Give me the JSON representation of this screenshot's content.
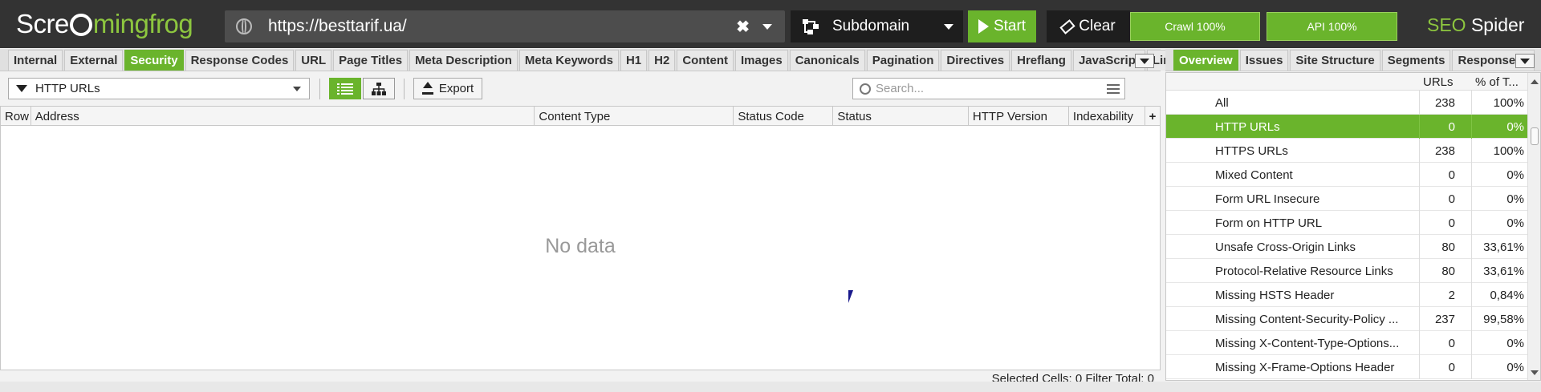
{
  "app": {
    "logo_left": "Scre",
    "logo_right": "mingfrog",
    "product_seo": "SEO",
    "product_spider": " Spider"
  },
  "topbar": {
    "url": "https://besttarif.ua/",
    "mode": "Subdomain",
    "start_label": "Start",
    "clear_label": "Clear",
    "crawl_progress": "Crawl 100%",
    "api_progress": "API 100%"
  },
  "colors": {
    "accent": "#6ab42c",
    "topbar": "#333333"
  },
  "left_tabs": [
    {
      "label": "Internal",
      "active": false
    },
    {
      "label": "External",
      "active": false
    },
    {
      "label": "Security",
      "active": true
    },
    {
      "label": "Response Codes",
      "active": false
    },
    {
      "label": "URL",
      "active": false
    },
    {
      "label": "Page Titles",
      "active": false
    },
    {
      "label": "Meta Description",
      "active": false
    },
    {
      "label": "Meta Keywords",
      "active": false
    },
    {
      "label": "H1",
      "active": false
    },
    {
      "label": "H2",
      "active": false
    },
    {
      "label": "Content",
      "active": false
    },
    {
      "label": "Images",
      "active": false
    },
    {
      "label": "Canonicals",
      "active": false
    },
    {
      "label": "Pagination",
      "active": false
    },
    {
      "label": "Directives",
      "active": false
    },
    {
      "label": "Hreflang",
      "active": false
    },
    {
      "label": "JavaScript",
      "active": false
    },
    {
      "label": "Links",
      "active": false
    }
  ],
  "right_tabs": [
    {
      "label": "Overview",
      "active": true
    },
    {
      "label": "Issues",
      "active": false
    },
    {
      "label": "Site Structure",
      "active": false
    },
    {
      "label": "Segments",
      "active": false
    },
    {
      "label": "Response Ti",
      "active": false
    }
  ],
  "toolbar": {
    "filter_value": "HTTP URLs",
    "export_label": "Export",
    "search_placeholder": "Search..."
  },
  "grid": {
    "columns": [
      "Row",
      "Address",
      "Content Type",
      "Status Code",
      "Status",
      "HTTP Version",
      "Indexability"
    ],
    "plus": "+",
    "empty_text": "No data"
  },
  "statusbar": {
    "text": "Selected Cells:  0  Filter Total:  0"
  },
  "overview": {
    "col_urls": "URLs",
    "col_pct": "% of T...",
    "rows": [
      {
        "label": "All",
        "urls": "238",
        "pct": "100%",
        "selected": false
      },
      {
        "label": "HTTP URLs",
        "urls": "0",
        "pct": "0%",
        "selected": true
      },
      {
        "label": "HTTPS URLs",
        "urls": "238",
        "pct": "100%",
        "selected": false
      },
      {
        "label": "Mixed Content",
        "urls": "0",
        "pct": "0%",
        "selected": false
      },
      {
        "label": "Form URL Insecure",
        "urls": "0",
        "pct": "0%",
        "selected": false
      },
      {
        "label": "Form on HTTP URL",
        "urls": "0",
        "pct": "0%",
        "selected": false
      },
      {
        "label": "Unsafe Cross-Origin Links",
        "urls": "80",
        "pct": "33,61%",
        "selected": false
      },
      {
        "label": "Protocol-Relative Resource Links",
        "urls": "80",
        "pct": "33,61%",
        "selected": false
      },
      {
        "label": "Missing HSTS Header",
        "urls": "2",
        "pct": "0,84%",
        "selected": false
      },
      {
        "label": "Missing Content-Security-Policy ...",
        "urls": "237",
        "pct": "99,58%",
        "selected": false
      },
      {
        "label": "Missing X-Content-Type-Options...",
        "urls": "0",
        "pct": "0%",
        "selected": false
      },
      {
        "label": "Missing X-Frame-Options Header",
        "urls": "0",
        "pct": "0%",
        "selected": false
      }
    ]
  }
}
